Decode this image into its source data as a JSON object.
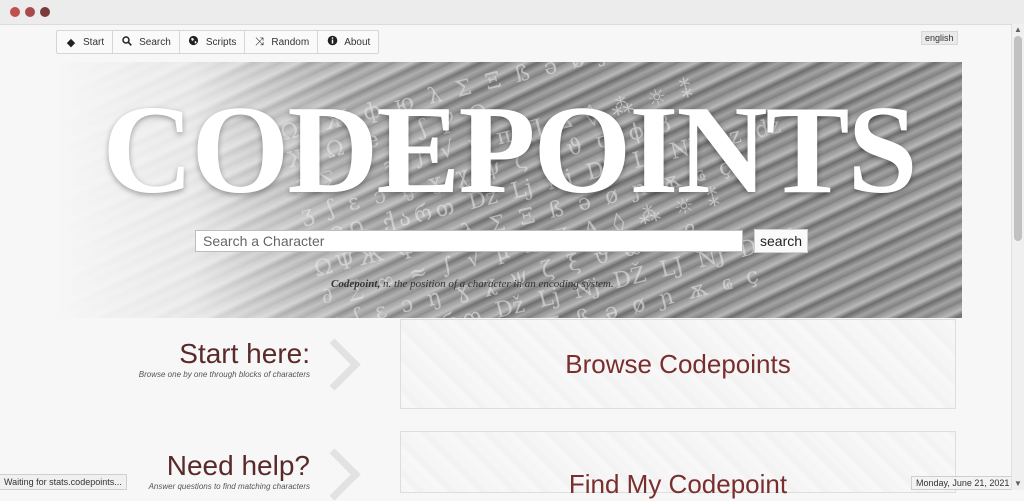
{
  "nav": {
    "items": [
      {
        "label": "Start",
        "icon": "direction-sign-icon"
      },
      {
        "label": "Search",
        "icon": "search-icon"
      },
      {
        "label": "Scripts",
        "icon": "globe-icon"
      },
      {
        "label": "Random",
        "icon": "shuffle-icon"
      },
      {
        "label": "About",
        "icon": "info-icon"
      }
    ],
    "language": "english"
  },
  "hero": {
    "title": "CODEPOINTS",
    "search_placeholder": "Search a Character",
    "search_button": "search",
    "definition_term": "Codepoint,",
    "definition_rest": "n. the position of a character in an encoding system."
  },
  "sections": {
    "start": {
      "title": "Start here:",
      "subtitle": "Browse one by one through blocks of characters",
      "card_label": "Browse Codepoints"
    },
    "help": {
      "title": "Need help?",
      "subtitle": "Answer questions to find matching characters",
      "card_label": "Find My Codepoint"
    }
  },
  "status": {
    "loading": "Waiting for stats.codepoints...",
    "date": "Monday, June 21, 2021"
  },
  "colors": {
    "accent": "#7a2e2e",
    "section_title": "#5a2a2a"
  }
}
